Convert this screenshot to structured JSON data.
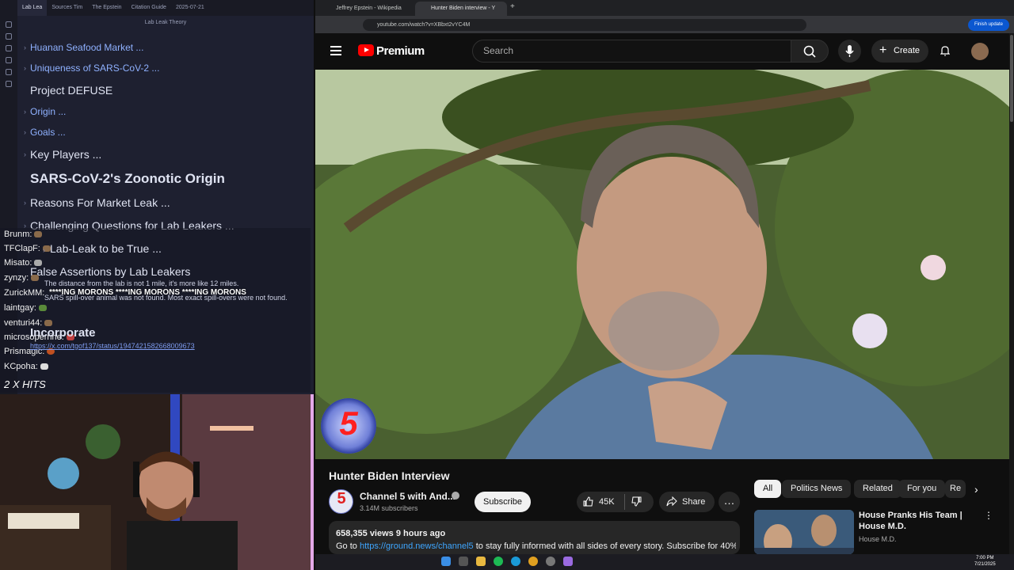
{
  "obsidian": {
    "tabs": [
      "Lab Lea",
      "Sources Tim",
      "The Epstein",
      "Citation Guide",
      "2025-07-21"
    ],
    "note_title": "Lab Leak Theory",
    "outline": [
      {
        "text": "Huanan Seafood Market ...",
        "style": "link"
      },
      {
        "text": "Uniqueness of SARS-CoV-2 ...",
        "style": "link"
      },
      {
        "text": "Project DEFUSE",
        "style": "h2"
      },
      {
        "text": "Origin ...",
        "style": "link"
      },
      {
        "text": "Goals ...",
        "style": "link"
      },
      {
        "text": "Key Players ...",
        "style": "h2"
      },
      {
        "text": "SARS-CoV-2's Zoonotic Origin",
        "style": "h1"
      },
      {
        "text": "Reasons For Market Leak ...",
        "style": "h2"
      },
      {
        "text": "Challenging Questions for Lab Leakers ...",
        "style": "h2"
      },
      {
        "text": "Lab-Leak to be True ...",
        "style": "h2"
      },
      {
        "text": "False Assertions by Lab Leakers",
        "style": "h2"
      }
    ],
    "bullet_1": "The distance from the lab is not 1 mile, it's more like 12 miles.",
    "bullet_2": "SARS spill-over animal was not found. Most exact spill-overs were not found.",
    "incorporate": "Incorporate",
    "incorporate_link": "https://x.com/tgof137/status/1947421582668009673"
  },
  "chat": {
    "messages": [
      {
        "user": "Brunm:",
        "text": ""
      },
      {
        "user": "TFClapF:",
        "text": ""
      },
      {
        "user": "Misato:",
        "text": ""
      },
      {
        "user": "zynzy:",
        "text": ""
      },
      {
        "user": "ZurickMM:",
        "text": ""
      },
      {
        "user": "laintgay:",
        "text": ""
      },
      {
        "user": "venturi44:",
        "text": ""
      },
      {
        "user": "microsoperrine:",
        "text": ""
      },
      {
        "user": "Prismagic:",
        "text": ""
      },
      {
        "user": "KCpoha:",
        "text": ""
      }
    ],
    "spam": "****ING MORONS  ****ING MORONS  ****ING MORONS",
    "hits": "2 X HITS"
  },
  "browser": {
    "tabs": [
      "Jeffrey Epstein - Wikipedia",
      "Hunter Biden interview - Y"
    ],
    "url": "youtube.com/watch?v=XBbxt2vYC4M",
    "finish_update": "Finish update"
  },
  "youtube": {
    "logo_text": "Premium",
    "search_placeholder": "Search",
    "create_label": "Create",
    "channel_badge": "5",
    "video_title": "Hunter Biden Interview",
    "channel_name": "Channel 5 with And...",
    "subscribers": "3.14M subscribers",
    "subscribe_label": "Subscribe",
    "likes": "45K",
    "share_label": "Share",
    "views_line": "658,355 views  9 hours ago",
    "desc_prefix": "Go to ",
    "desc_link": "https://ground.news/channel5",
    "desc_suffix": " to stay fully informed with all sides of every story. Subscribe for 40%",
    "chips": [
      "All",
      "Politics News",
      "Related",
      "For you",
      "Re"
    ],
    "related": {
      "title": "House Pranks His Team | House M.D.",
      "channel": "House M.D."
    }
  },
  "taskbar": {
    "time": "7:00 PM",
    "date": "7/21/2025"
  },
  "colors": {
    "accent_red": "#ff0000",
    "link_blue": "#3ea6ff",
    "obsidian_link": "#8fb1ff",
    "finish_blue": "#0b57d0"
  }
}
